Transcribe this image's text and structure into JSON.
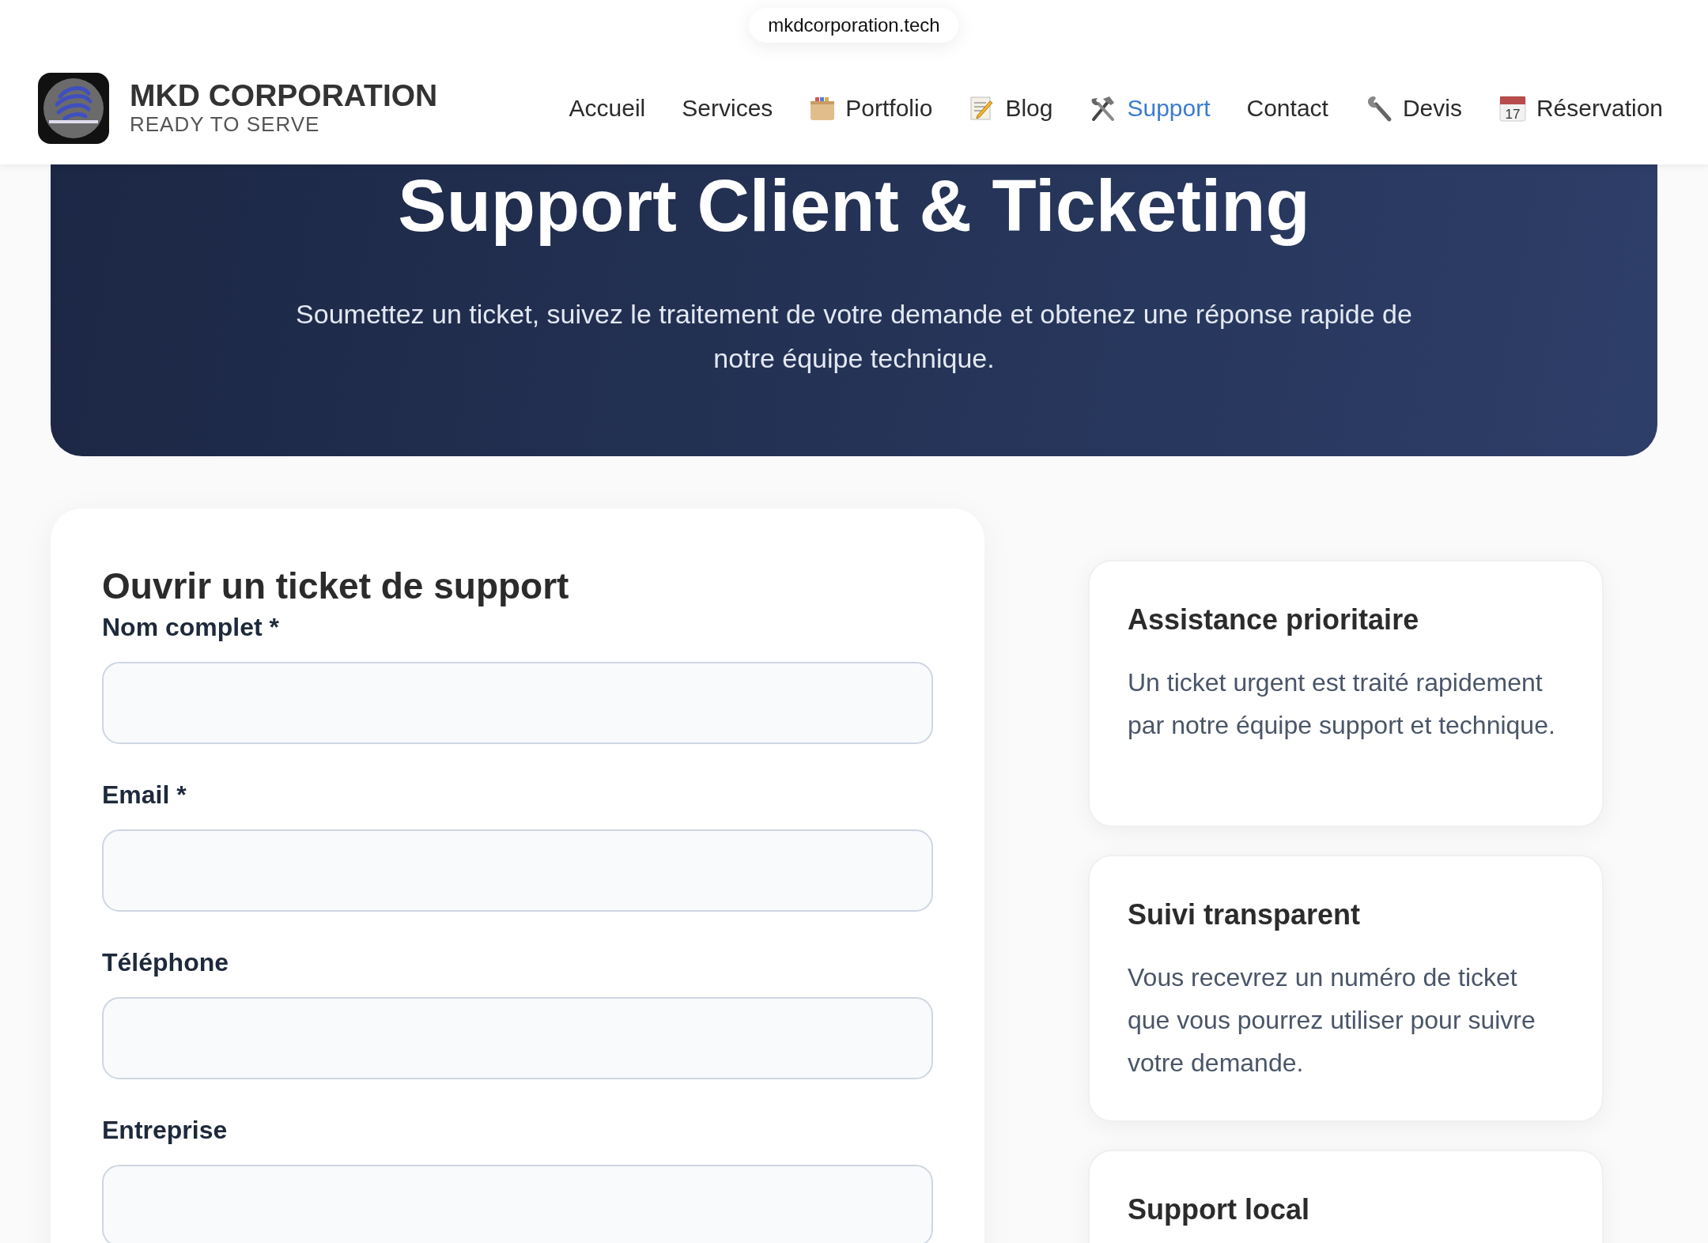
{
  "url_bar": {
    "address": "mkdcorporation.tech"
  },
  "header": {
    "brand": {
      "name": "MKD CORPORATION",
      "tagline": "READY TO SERVE"
    },
    "nav": [
      {
        "label": "Accueil",
        "selected": false
      },
      {
        "label": "Services",
        "selected": false
      },
      {
        "label": "Portfolio",
        "kind": "box",
        "selected": false
      },
      {
        "label": "Blog",
        "kind": "notepad",
        "selected": false
      },
      {
        "label": "Support",
        "kind": "tools",
        "selected": true
      },
      {
        "label": "Contact",
        "selected": false
      },
      {
        "label": "Devis",
        "kind": "wrench",
        "selected": false
      },
      {
        "label": "Réservation",
        "kind": "calendar",
        "icon_text": "17",
        "selected": false
      }
    ]
  },
  "hero": {
    "title": "Support Client & Ticketing",
    "subtitle": "Soumettez un ticket, suivez le traitement de votre demande et obtenez une réponse rapide de notre équipe technique."
  },
  "form": {
    "title": "Ouvrir un ticket de support",
    "fields": [
      {
        "label": "Nom complet *"
      },
      {
        "label": "Email *"
      },
      {
        "label": "Téléphone"
      },
      {
        "label": "Entreprise"
      }
    ]
  },
  "info_cards": [
    {
      "title": "Assistance prioritaire",
      "text": "Un ticket urgent est traité rapidement par notre équipe support et technique."
    },
    {
      "title": "Suivi transparent",
      "text": "Vous recevrez un numéro de ticket que vous pourrez utiliser pour suivre votre demande."
    },
    {
      "title": "Support local"
    }
  ]
}
